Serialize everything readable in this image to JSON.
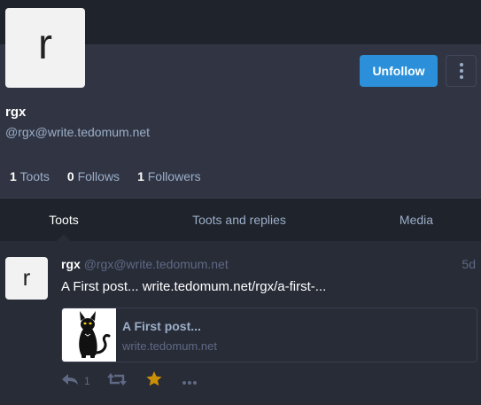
{
  "profile": {
    "avatar_letter": "r",
    "display_name": "rgx",
    "handle": "@rgx@write.tedomum.net",
    "unfollow_label": "Unfollow",
    "counters": [
      {
        "count": "1",
        "label": "Toots"
      },
      {
        "count": "0",
        "label": "Follows"
      },
      {
        "count": "1",
        "label": "Followers"
      }
    ]
  },
  "tabs": [
    "Toots",
    "Toots and replies",
    "Media"
  ],
  "active_tab": "Toots",
  "status": {
    "avatar_letter": "r",
    "display_name": "rgx",
    "account": "@rgx@write.tedomum.net",
    "time": "5d",
    "text": "A First post... write.tedomum.net/rgx/a-first-...",
    "card": {
      "title": "A First post...",
      "url": "write.tedomum.net",
      "thumb_icon": "black-cat-image"
    },
    "actions": {
      "reply_count": "1",
      "reply_icon": "reply-icon",
      "boost_icon": "boost-icon",
      "favourite_icon": "star-icon",
      "more_icon": "ellipsis-icon"
    }
  },
  "colors": {
    "accent": "#2b90d9",
    "background": "#282c37",
    "profile_background": "#313543",
    "header_background": "#1f232b",
    "favourite": "#ca8f04"
  }
}
